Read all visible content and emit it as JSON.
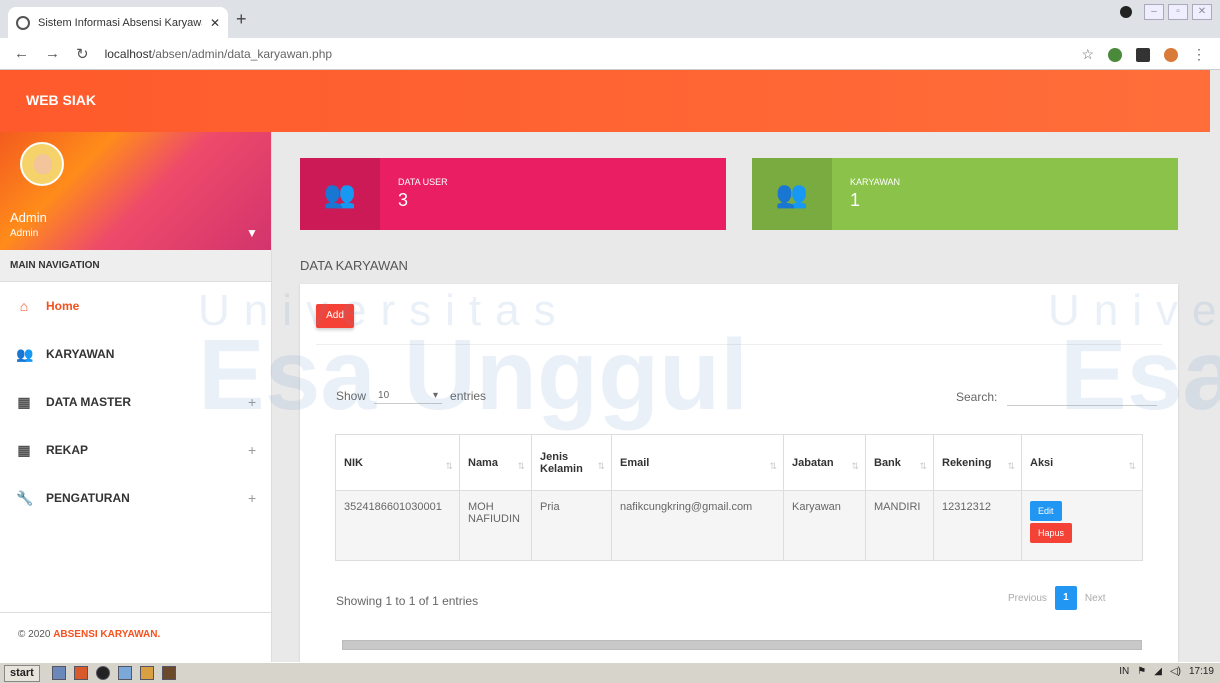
{
  "browser": {
    "tab_title": "Sistem Informasi Absensi Karyawan",
    "url_host": "localhost",
    "url_path": "/absen/admin/data_karyawan.php"
  },
  "app": {
    "logo": "WEB SIAK"
  },
  "sidebar": {
    "user_name": "Admin",
    "user_role": "Admin",
    "nav_header": "MAIN NAVIGATION",
    "items": [
      {
        "label": "Home",
        "icon": "home-icon"
      },
      {
        "label": "KARYAWAN",
        "icon": "people-icon"
      },
      {
        "label": "DATA MASTER",
        "icon": "grid-icon"
      },
      {
        "label": "REKAP",
        "icon": "grid-icon"
      },
      {
        "label": "PENGATURAN",
        "icon": "wrench-icon"
      }
    ],
    "footer_prefix": "© 2020",
    "footer_brand": "ABSENSI KARYAWAN."
  },
  "infoboxes": [
    {
      "label": "DATA USER",
      "value": "3",
      "color": "#e91e63"
    },
    {
      "label": "KARYAWAN",
      "value": "1",
      "color": "#8bc34a"
    }
  ],
  "section_title": "DATA KARYAWAN",
  "card": {
    "add_label": "Add",
    "show_label": "Show",
    "entries_value": "10",
    "entries_label": "entries",
    "search_label": "Search:",
    "columns": [
      "NIK",
      "Nama",
      "Jenis Kelamin",
      "Email",
      "Jabatan",
      "Bank",
      "Rekening",
      "Aksi"
    ],
    "rows": [
      {
        "nik": "3524186601030001",
        "nama": "MOH NAFIUDIN",
        "jenis_kelamin": "Pria",
        "email": "nafikcungkring@gmail.com",
        "jabatan": "Karyawan",
        "bank": "MANDIRI",
        "rekening": "12312312",
        "edit_label": "Edit",
        "hapus_label": "Hapus"
      }
    ],
    "info": "Showing 1 to 1 of 1 entries",
    "pager": {
      "previous": "Previous",
      "current": "1",
      "next": "Next"
    }
  },
  "watermark": {
    "line1": "Universitas",
    "line2": "Esa Unggul",
    "right1": "Unive",
    "right2": "Esa"
  },
  "taskbar": {
    "start": "start",
    "lang": "IN",
    "time": "17:19"
  }
}
